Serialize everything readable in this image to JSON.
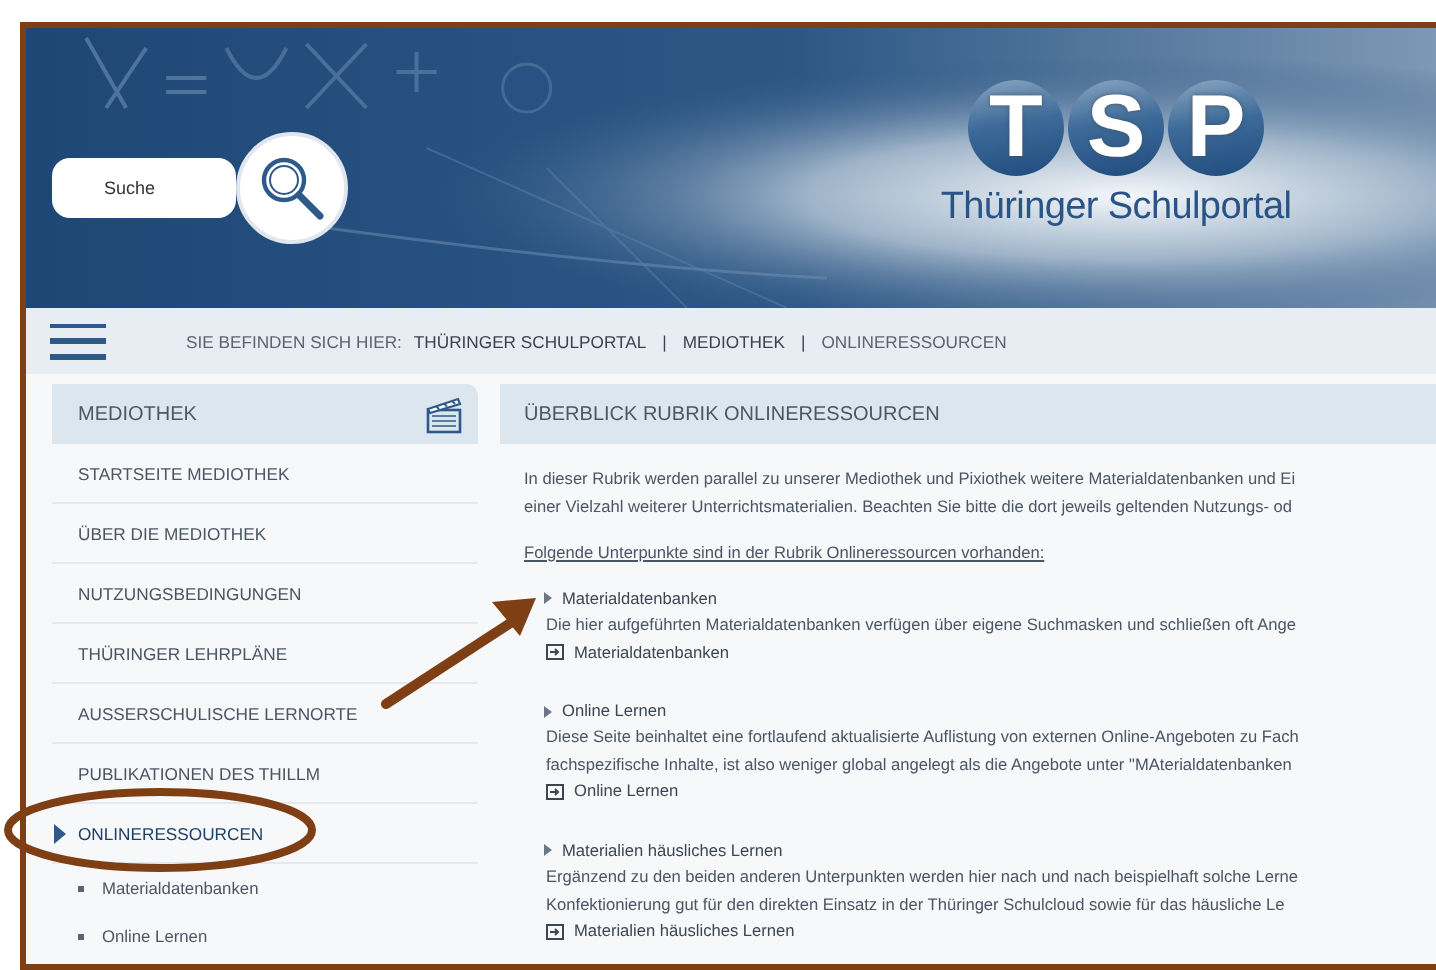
{
  "header": {
    "search": {
      "placeholder": "Suche"
    },
    "logo": {
      "letters": [
        "T",
        "S",
        "P"
      ],
      "name": "Thüringer Schulportal"
    }
  },
  "breadcrumb": {
    "label": "SIE BEFINDEN SICH HIER:",
    "items": [
      "THÜRINGER SCHULPORTAL",
      "MEDIOTHEK",
      "ONLINERESSOURCEN"
    ],
    "separators": [
      "|",
      "|"
    ]
  },
  "sidebar": {
    "title": "MEDIOTHEK",
    "items": [
      {
        "label": "STARTSEITE MEDIOTHEK",
        "selected": false
      },
      {
        "label": "ÜBER DIE MEDIOTHEK",
        "selected": false
      },
      {
        "label": "NUTZUNGSBEDINGUNGEN",
        "selected": false
      },
      {
        "label": "THÜRINGER LEHRPLÄNE",
        "selected": false
      },
      {
        "label": "AUSSERSCHULISCHE LERNORTE",
        "selected": false
      },
      {
        "label": "PUBLIKATIONEN DES THILLM",
        "selected": false
      },
      {
        "label": "ONLINERESSOURCEN",
        "selected": true,
        "children": [
          {
            "label": "Materialdatenbanken"
          },
          {
            "label": "Online Lernen"
          }
        ]
      }
    ]
  },
  "main": {
    "title": "ÜBERBLICK RUBRIK ONLINERESSOURCEN",
    "intro": [
      "In dieser Rubrik werden parallel zu unserer Mediothek und Pixiothek weitere Materialdatenbanken und Ei",
      "einer Vielzahl weiterer Unterrichtsmaterialien. Beachten Sie bitte die dort jeweils geltenden Nutzungs- od"
    ],
    "lead": "Folgende Unterpunkte sind in der Rubrik Onlineressourcen vorhanden:",
    "sections": [
      {
        "title": "Materialdatenbanken",
        "lines": [
          "Die hier aufgeführten Materialdatenbanken verfügen über eigene Suchmasken und schließen oft Ange"
        ],
        "link": "Materialdatenbanken"
      },
      {
        "title": "Online Lernen",
        "lines": [
          "Diese Seite beinhaltet eine fortlaufend aktualisierte Auflistung von externen Online-Angeboten zu Fach",
          "fachspezifische Inhalte, ist also weniger global angelegt als die Angebote unter \"MAterialdatenbanken"
        ],
        "link": "Online Lernen"
      },
      {
        "title": "Materialien häusliches Lernen",
        "lines": [
          "Ergänzend zu den beiden anderen Unterpunkten werden hier nach und nach beispielhaft solche Lerne",
          "Konfektionierung gut für den direkten Einsatz in der Thüringer Schulcloud sowie für das häusliche Le"
        ],
        "link": "Materialien häusliches Lernen"
      }
    ]
  }
}
